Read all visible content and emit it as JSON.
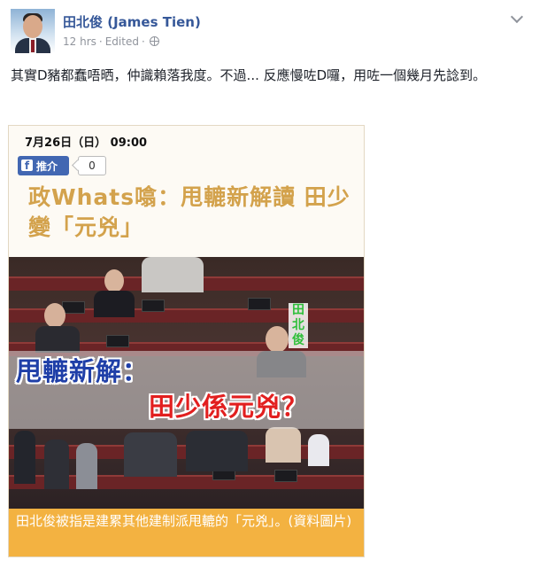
{
  "post": {
    "author_name": "田北俊 (James Tien)",
    "time": "12 hrs",
    "edited": "Edited",
    "text": "其實D豬都蠢唔晒，仲識賴落我度。不過... 反應慢咗D囉，用咗一個幾月先諗到。"
  },
  "card": {
    "datetime": "7月26日（日）  09:00",
    "like_label": "推介",
    "like_count": "0",
    "headline": "政Whats噏：甩轆新解讀 田少變「元兇」",
    "photo_name_label": "田北俊",
    "overlay_line1": "甩轆新解：",
    "overlay_line2": "田少係元兇？",
    "caption": "田北俊被指是建累其他建制派甩轆的「元兇」。(資料圖片)"
  },
  "icons": {
    "globe": "globe-icon",
    "chevron": "chevron-down-icon",
    "facebook": "facebook-icon"
  },
  "colors": {
    "author_link": "#365899",
    "meta_gray": "#90949c",
    "headline_gold": "#d3a24c",
    "caption_orange": "#f3b241",
    "overlay_blue": "#1f3fa8",
    "overlay_red": "#e21f1f",
    "name_green": "#2fbf3a"
  }
}
